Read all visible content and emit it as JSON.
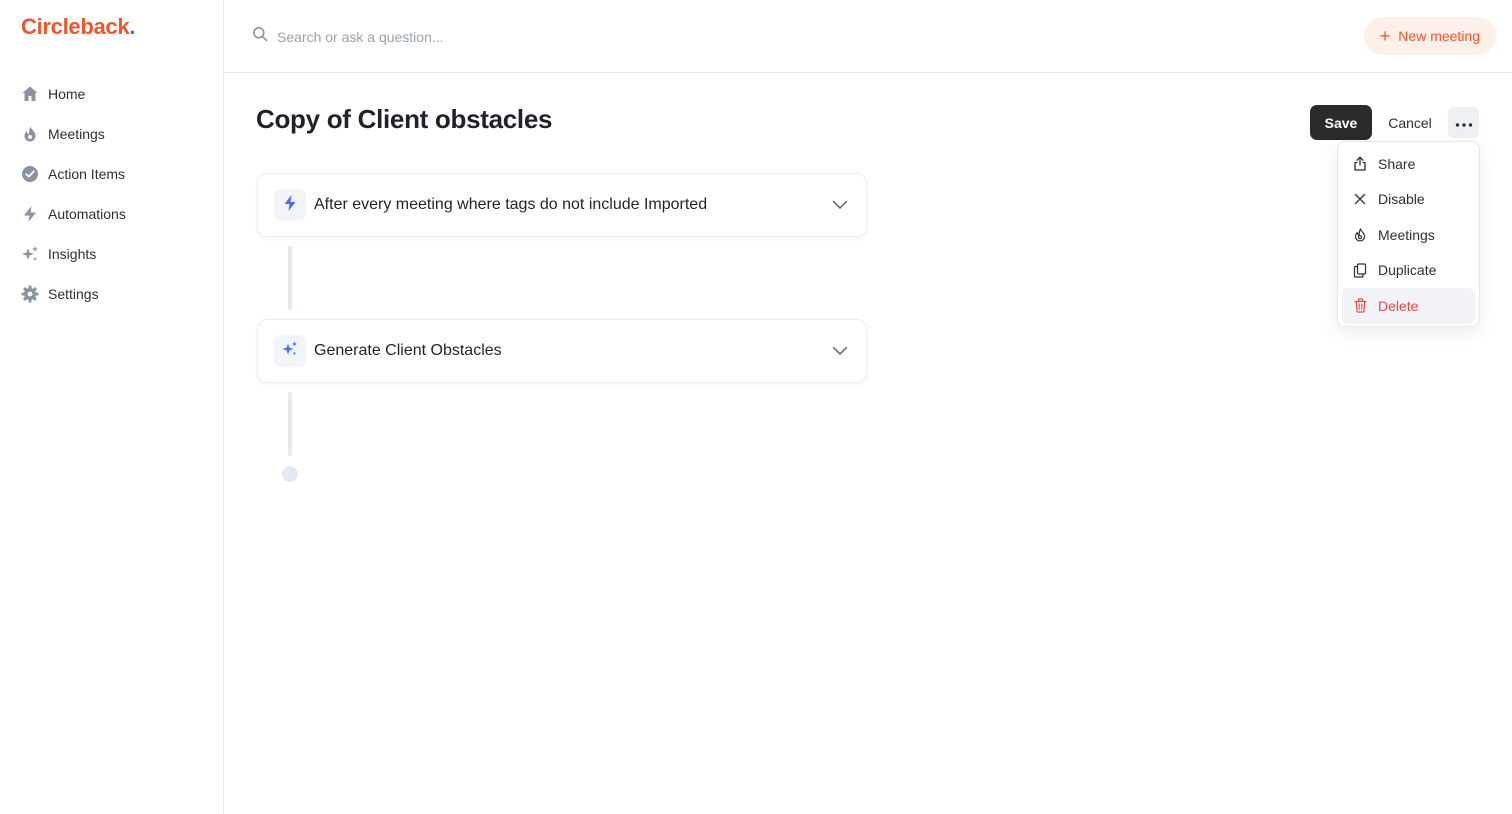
{
  "app": {
    "logo_text": "Circleback",
    "logo_dot": ".",
    "brand_color": "#f0562e",
    "accent_color": "#3a6cf5"
  },
  "sidebar": {
    "items": [
      {
        "label": "Home",
        "icon": "home-icon"
      },
      {
        "label": "Meetings",
        "icon": "flame-icon"
      },
      {
        "label": "Action Items",
        "icon": "check-circle-icon"
      },
      {
        "label": "Automations",
        "icon": "bolt-icon"
      },
      {
        "label": "Insights",
        "icon": "sparkles-icon"
      },
      {
        "label": "Settings",
        "icon": "gear-icon"
      }
    ]
  },
  "topbar": {
    "search_placeholder": "Search or ask a question...",
    "new_meeting_label": "New meeting"
  },
  "page": {
    "title": "Copy of Client obstacles",
    "save_label": "Save",
    "cancel_label": "Cancel"
  },
  "menu": {
    "items": [
      {
        "label": "Share",
        "icon": "share-icon"
      },
      {
        "label": "Disable",
        "icon": "close-icon"
      },
      {
        "label": "Meetings",
        "icon": "flame-icon"
      },
      {
        "label": "Duplicate",
        "icon": "copy-icon"
      },
      {
        "label": "Delete",
        "icon": "trash-icon",
        "danger_color": "#e5484d"
      }
    ]
  },
  "flow": {
    "trigger": {
      "label": "After every meeting where tags do not include Imported",
      "icon": "bolt-icon"
    },
    "step": {
      "label": "Generate Client Obstacles",
      "icon": "sparkles-icon"
    }
  }
}
